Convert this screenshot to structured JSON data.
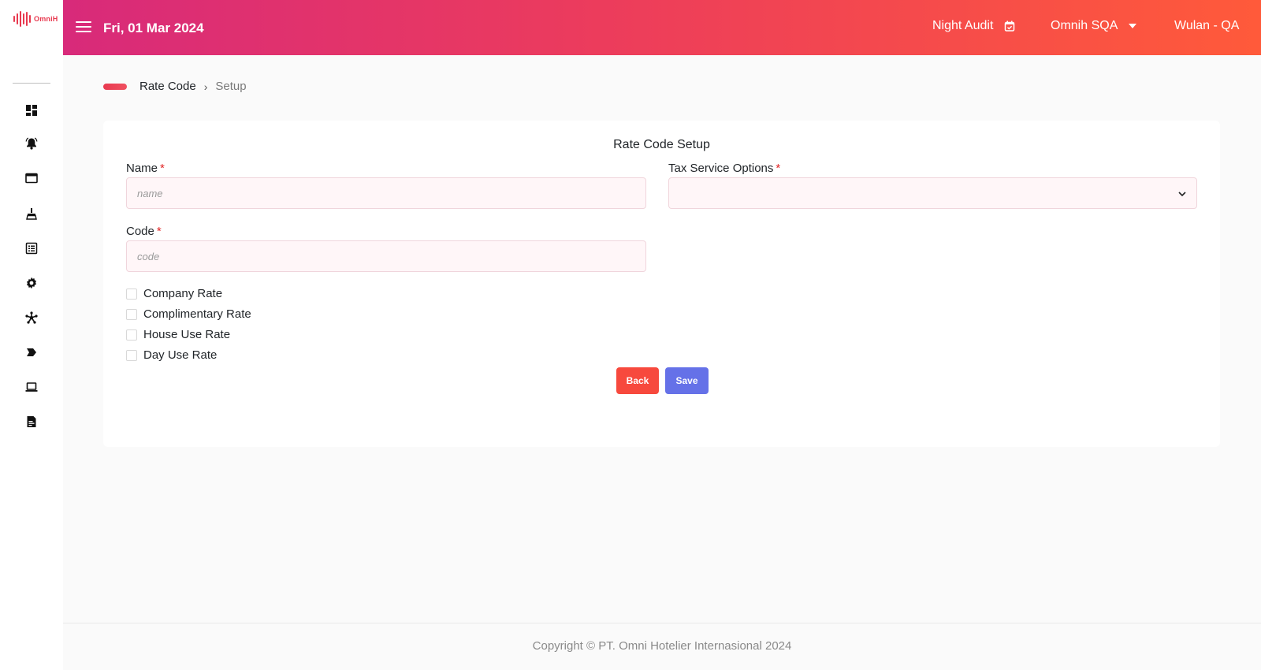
{
  "app": {
    "logo_text": "OmniH"
  },
  "header": {
    "date": "Fri, 01 Mar 2024",
    "night_audit_label": "Night Audit",
    "hotel_name": "Omnih SQA",
    "user": "Wulan - QA"
  },
  "sidebar": {
    "icons": [
      "dashboard-icon",
      "bell-icon",
      "window-icon",
      "cleaning-icon",
      "list-icon",
      "gear-icon",
      "network-icon",
      "tag-arrow-icon",
      "laptop-icon",
      "document-icon"
    ]
  },
  "breadcrumb": {
    "parent": "Rate Code",
    "separator": "›",
    "current": "Setup"
  },
  "form": {
    "title": "Rate Code Setup",
    "name_label": "Name",
    "name_placeholder": "name",
    "name_value": "",
    "code_label": "Code",
    "code_placeholder": "code",
    "code_value": "",
    "tax_label": "Tax Service Options",
    "tax_value": "",
    "required_mark": "*",
    "checkboxes": [
      {
        "label": "Company Rate",
        "checked": false
      },
      {
        "label": "Complimentary Rate",
        "checked": false
      },
      {
        "label": "House Use Rate",
        "checked": false
      },
      {
        "label": "Day Use Rate",
        "checked": false
      }
    ],
    "back_label": "Back",
    "save_label": "Save"
  },
  "footer": {
    "copyright": "Copyright © PT. Omni Hotelier Internasional 2024"
  },
  "colors": {
    "accent": "#e8394f",
    "header_gradient_start": "#d82a7a",
    "header_gradient_end": "#ff5a3a",
    "back_button": "#f7493d",
    "save_button": "#6571e8"
  }
}
